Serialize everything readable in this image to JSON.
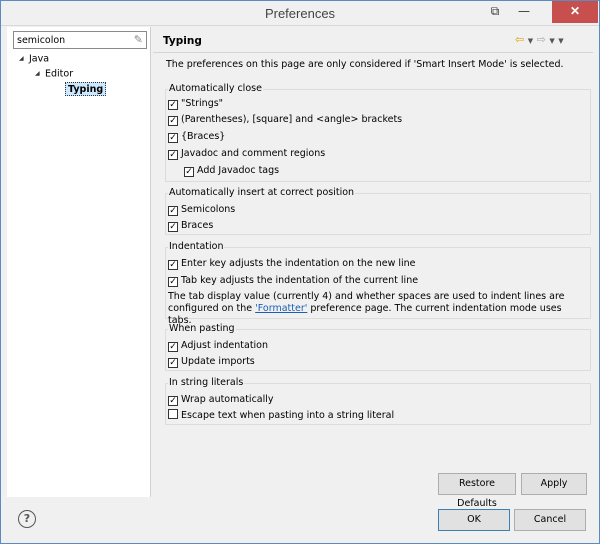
{
  "window": {
    "title": "Preferences",
    "restore_glyph": "⧉",
    "min_glyph": "—",
    "close_glyph": "✕"
  },
  "nav": {
    "filter_value": "semicolon",
    "tree": [
      {
        "label": "Java"
      },
      {
        "label": "Editor"
      },
      {
        "label": "Typing"
      }
    ]
  },
  "page": {
    "title": "Typing",
    "info": "The preferences on this page are only considered if 'Smart Insert Mode' is selected."
  },
  "groups": {
    "auto_close": {
      "title": "Automatically close",
      "options": [
        {
          "label": "\"Strings\"",
          "checked": true
        },
        {
          "label": "(Parentheses), [square] and <angle> brackets",
          "checked": true
        },
        {
          "label": "{Braces}",
          "checked": true
        },
        {
          "label": "Javadoc and comment regions",
          "checked": true
        },
        {
          "label": "Add Javadoc tags",
          "checked": true
        }
      ]
    },
    "auto_insert": {
      "title": "Automatically insert at correct position",
      "options": [
        {
          "label": "Semicolons",
          "checked": true
        },
        {
          "label": "Braces",
          "checked": true
        }
      ]
    },
    "indentation": {
      "title": "Indentation",
      "options": [
        {
          "label": "Enter key adjusts the indentation on the new line",
          "checked": true
        },
        {
          "label": "Tab key adjusts the indentation of the current line",
          "checked": true
        }
      ],
      "note_prefix": "The tab display value (currently 4) and whether spaces are used to indent lines are configured on the ",
      "note_link": "'Formatter'",
      "note_suffix": " preference page. The current indentation mode uses tabs."
    },
    "pasting": {
      "title": "When pasting",
      "options": [
        {
          "label": "Adjust indentation",
          "checked": true
        },
        {
          "label": "Update imports",
          "checked": true
        }
      ]
    },
    "string_literals": {
      "title": "In string literals",
      "options": [
        {
          "label": "Wrap automatically",
          "checked": true
        },
        {
          "label": "Escape text when pasting into a string literal",
          "checked": false
        }
      ]
    }
  },
  "buttons": {
    "restore_defaults": "Restore Defaults",
    "apply": "Apply",
    "ok": "OK",
    "cancel": "Cancel"
  },
  "icons": {
    "help": "?",
    "clear": "✎",
    "tree_expanded": "◢",
    "back": "⇦",
    "forward": "⇨",
    "dropdown": "▼",
    "menu": "▼",
    "check": "✓"
  }
}
